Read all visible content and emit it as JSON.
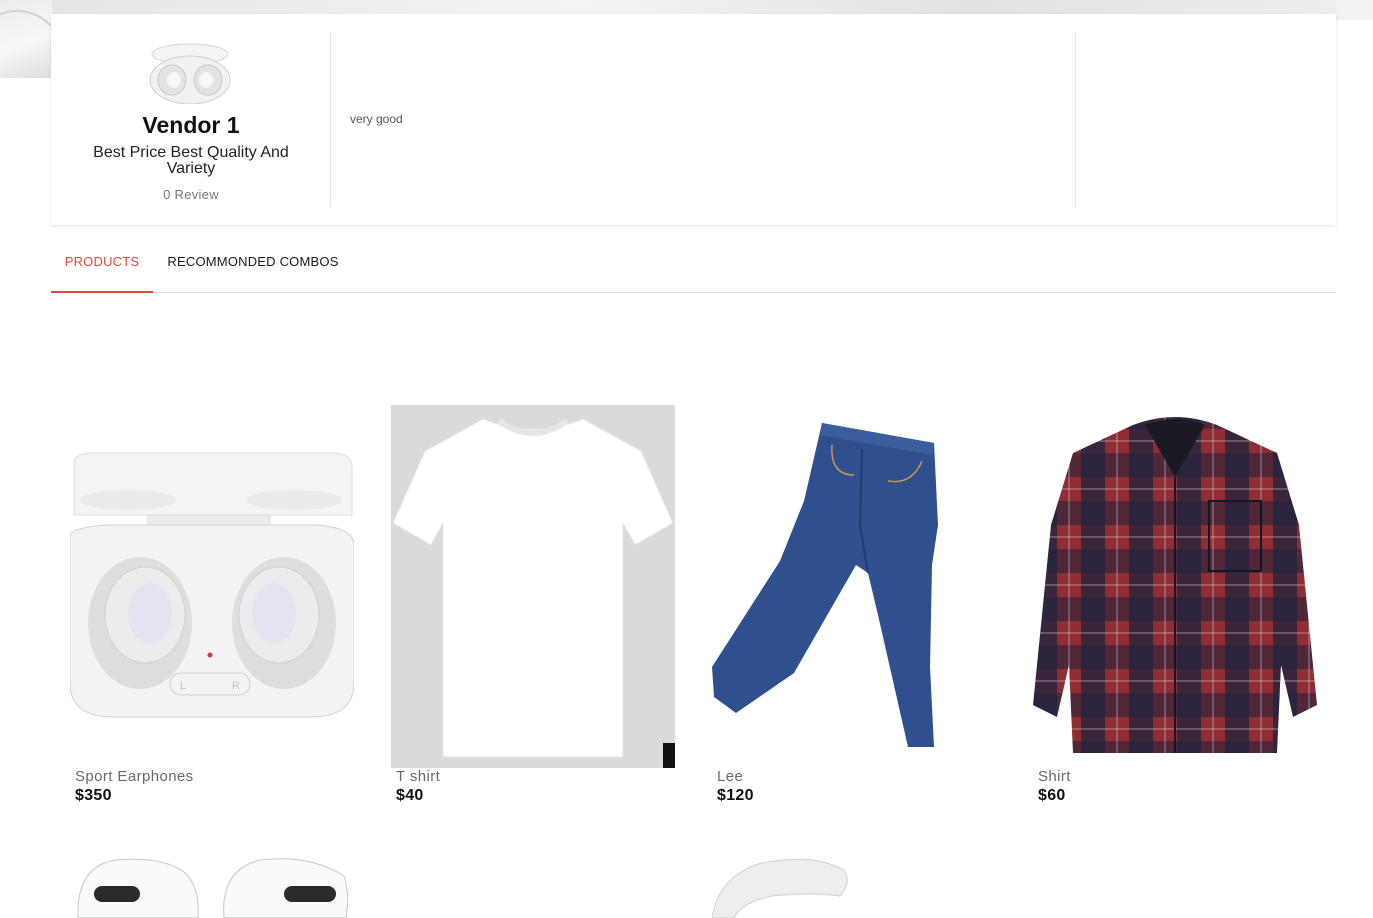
{
  "vendor": {
    "name": "Vendor 1",
    "tagline": "Best Price Best Quality And Variety",
    "review_count": "0 Review",
    "description": "very good",
    "logo_icon": "earbuds-case-logo"
  },
  "tabs": [
    {
      "label": "PRODUCTS",
      "active": true
    },
    {
      "label": "RECOMMONDED COMBOS",
      "active": false
    }
  ],
  "products": [
    {
      "name": "Sport Earphones",
      "price": "$350",
      "image_icon": "earbuds-case-image"
    },
    {
      "name": "T shirt",
      "price": "$40",
      "image_icon": "white-tshirt-image"
    },
    {
      "name": "Lee",
      "price": "$120",
      "image_icon": "blue-jeans-image"
    },
    {
      "name": "Shirt",
      "price": "$60",
      "image_icon": "plaid-shirt-image"
    }
  ],
  "colors": {
    "accent": "#e0483a",
    "tshirt_bg": "#d9dadb",
    "denim": "#2f4f8f",
    "plaid_red": "#8e2d33",
    "plaid_navy": "#1e2340"
  }
}
